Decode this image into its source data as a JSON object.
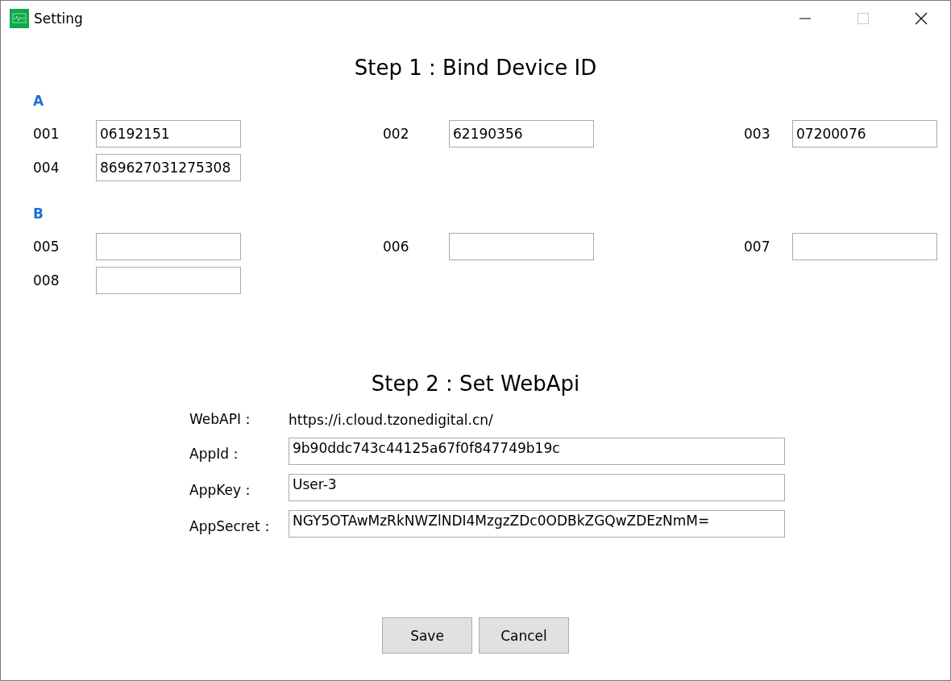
{
  "window": {
    "title": "Setting",
    "maximize_disabled": true
  },
  "step1": {
    "title": "Step 1 : Bind Device ID",
    "groups": [
      {
        "name": "A",
        "devices": [
          {
            "label": "001",
            "value": "06192151"
          },
          {
            "label": "002",
            "value": "62190356"
          },
          {
            "label": "003",
            "value": "07200076"
          },
          {
            "label": "004",
            "value": "869627031275308"
          }
        ]
      },
      {
        "name": "B",
        "devices": [
          {
            "label": "005"
          },
          {
            "label": "006"
          },
          {
            "label": "007"
          },
          {
            "label": "008"
          }
        ]
      }
    ]
  },
  "step2": {
    "title": "Step 2 : Set WebApi",
    "fields": [
      {
        "kind": "text",
        "label": "WebAPI：",
        "value": "https://i.cloud.tzonedigital.cn/"
      },
      {
        "kind": "input",
        "label": "AppId：",
        "value": "9b90ddc743c44125a67f0f847749b19c"
      },
      {
        "kind": "input",
        "label": "AppKey：",
        "value": "User-3"
      },
      {
        "kind": "input",
        "label": "AppSecret：",
        "value": "NGY5OTAwMzRkNWZlNDI4MzgzZDc0ODBkZGQwZDEzNmM="
      }
    ]
  },
  "buttons": [
    "Save",
    "Cancel"
  ]
}
